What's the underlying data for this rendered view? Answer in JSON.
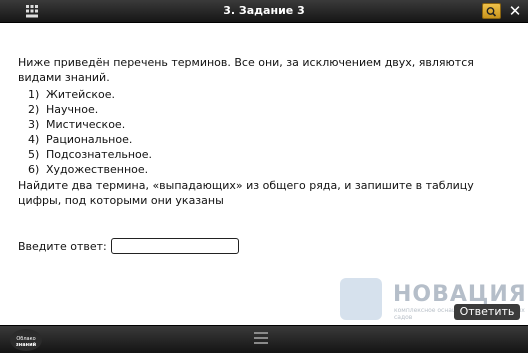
{
  "header": {
    "title": "3. Задание 3"
  },
  "task": {
    "intro": "Ниже приведён перечень терминов. Все они, за исключением двух, являются видами знаний.",
    "items": [
      {
        "num": "1)",
        "text": "Житейское."
      },
      {
        "num": "2)",
        "text": "Научное."
      },
      {
        "num": "3)",
        "text": "Мистическое."
      },
      {
        "num": "4)",
        "text": "Рациональное."
      },
      {
        "num": "5)",
        "text": "Подсознательное."
      },
      {
        "num": "6)",
        "text": "Художественное."
      }
    ],
    "instruction": "Найдите два термина, «выпадающих» из общего ряда, и запишите в таблицу цифры, под которыми они указаны"
  },
  "answer": {
    "label": "Введите ответ:",
    "value": "",
    "button_label": "Ответить"
  },
  "watermark": {
    "brand": "НОВАЦИЯ",
    "subtitle": "комплексное оснащение школ и детских садов"
  },
  "footer": {
    "logo_line1": "Облако",
    "logo_line2": "знаний"
  },
  "colors": {
    "bar_dark": "#1e1e1e",
    "search_button": "#e0b030",
    "answer_button": "#3b3b3b"
  }
}
